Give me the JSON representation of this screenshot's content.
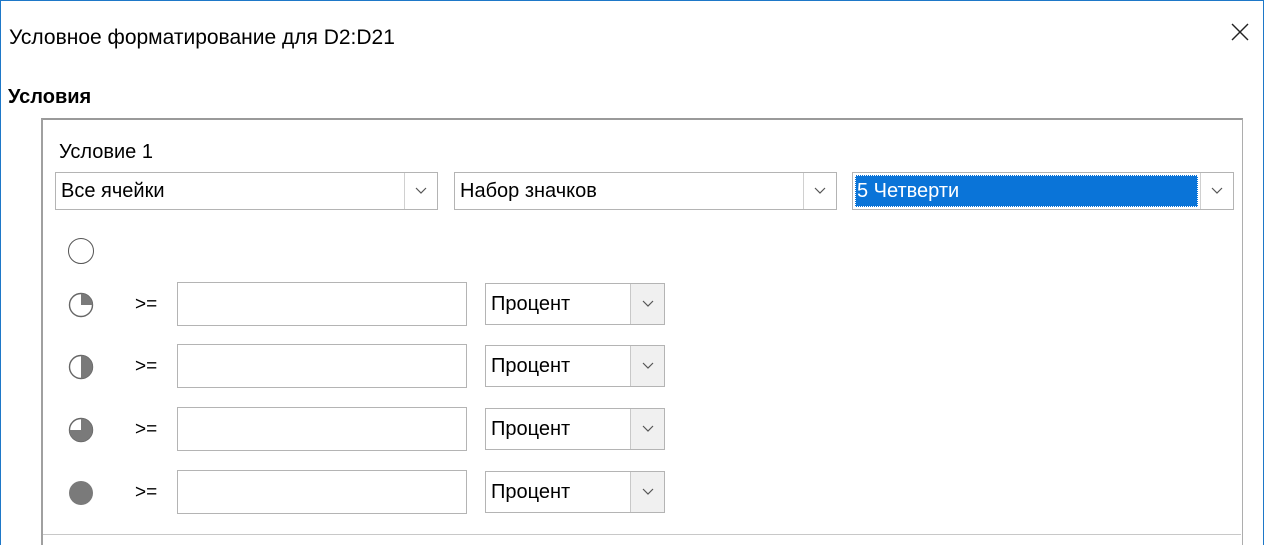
{
  "window": {
    "title": "Условное форматирование для D2:D21",
    "close_glyph": "✕"
  },
  "section": {
    "label": "Условия"
  },
  "condition": {
    "title": "Условие 1",
    "apply_to": "Все ячейки",
    "format_type": "Набор значков",
    "icon_set": "5 Четверти",
    "entries": [
      {
        "icon": "pie-quarter-icon",
        "operator": ">=",
        "value": "",
        "type": "Процент"
      },
      {
        "icon": "pie-half-icon",
        "operator": ">=",
        "value": "",
        "type": "Процент"
      },
      {
        "icon": "pie-three-quarters-icon",
        "operator": ">=",
        "value": "",
        "type": "Процент"
      },
      {
        "icon": "pie-full-icon",
        "operator": ">=",
        "value": "",
        "type": "Процент"
      }
    ]
  },
  "colors": {
    "accent": "#0a74d8",
    "window_border": "#1e78c8",
    "icon_fill": "#7a7a7a"
  }
}
